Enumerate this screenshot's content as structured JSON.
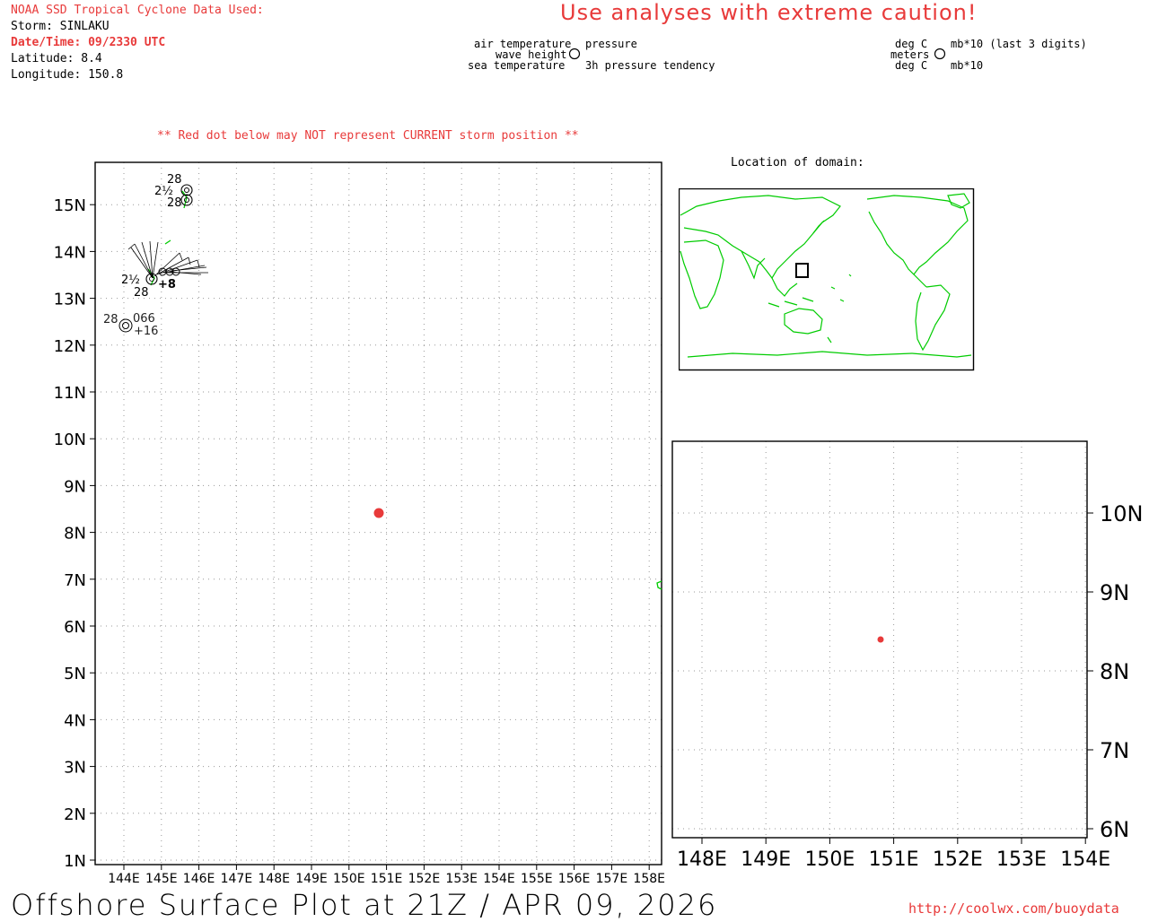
{
  "header": {
    "source": "NOAA SSD Tropical Cyclone Data Used:",
    "storm": "Storm: SINLAKU",
    "datetime": "Date/Time: 09/2330 UTC",
    "latitude": "Latitude: 8.4",
    "longitude": "Longitude: 150.8",
    "caution": "Use analyses with extreme caution!"
  },
  "legend": {
    "left": {
      "air_temperature": "air temperature",
      "wave_height": "wave height",
      "sea_temperature": "sea temperature",
      "pressure": "pressure",
      "tendency": "3h pressure tendency"
    },
    "right": {
      "deg_c_top": "deg C",
      "meters": "meters",
      "deg_c_bottom": "deg C",
      "mb_last3": "mb*10 (last 3 digits)",
      "mb10": "mb*10"
    }
  },
  "notice": "** Red dot below may NOT represent CURRENT storm position **",
  "location_title": "Location of domain:",
  "main_map": {
    "lat_labels": [
      "1N",
      "2N",
      "3N",
      "4N",
      "5N",
      "6N",
      "7N",
      "8N",
      "9N",
      "10N",
      "11N",
      "12N",
      "13N",
      "14N",
      "15N"
    ],
    "lon_labels": [
      "144E",
      "145E",
      "146E",
      "147E",
      "148E",
      "149E",
      "150E",
      "151E",
      "152E",
      "153E",
      "154E",
      "155E",
      "156E",
      "157E",
      "158E"
    ],
    "station_labels": {
      "s1_temp": "28",
      "s1_wave": "2½",
      "s1_sea": "28",
      "s2_wave": "2½",
      "s2_sea": "28",
      "s2_tend": "+8",
      "s3_temp": "28",
      "s3_press": "066",
      "s3_tend": "+16"
    }
  },
  "inset_map": {
    "lat_labels": [
      "6N",
      "7N",
      "8N",
      "9N",
      "10N"
    ],
    "lon_labels": [
      "148E",
      "149E",
      "150E",
      "151E",
      "152E",
      "153E",
      "154E"
    ]
  },
  "footer": {
    "title": "Offshore Surface Plot at 21Z / APR 09, 2026",
    "url": "http://coolwx.com/buoydata"
  },
  "colors": {
    "storm_dot": "#e83a3a",
    "coastline": "#00cc00",
    "caution_text": "#e83a3a"
  }
}
